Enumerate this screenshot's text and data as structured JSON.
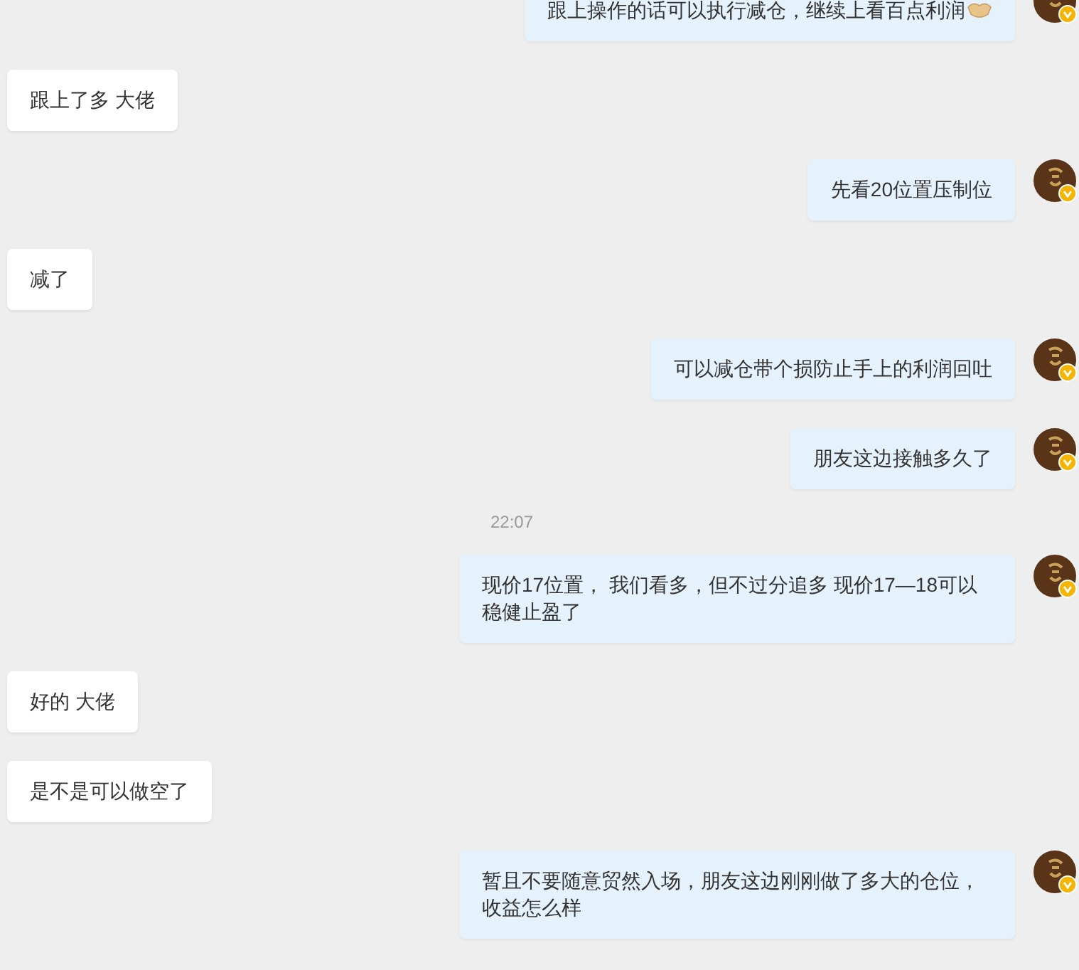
{
  "messages": [
    {
      "kind": "sent",
      "text": "跟上操作的话可以执行减仓，继续上看百点利润",
      "emoji": true
    },
    {
      "kind": "received",
      "text": "跟上了多 大佬"
    },
    {
      "kind": "sent",
      "text": "先看20位置压制位"
    },
    {
      "kind": "received",
      "text": "减了"
    },
    {
      "kind": "sent",
      "text": "可以减仓带个损防止手上的利润回吐"
    },
    {
      "kind": "sent",
      "text": "朋友这边接触多久了"
    },
    {
      "kind": "time",
      "text": "22:07"
    },
    {
      "kind": "sent",
      "text": "现价17位置， 我们看多，但不过分追多 现价17—18可以稳健止盈了"
    },
    {
      "kind": "received",
      "text": "好的 大佬"
    },
    {
      "kind": "received",
      "text": "是不是可以做空了"
    },
    {
      "kind": "sent",
      "text": "暂且不要随意贸然入场，朋友这边刚刚做了多大的仓位，收益怎么样"
    }
  ]
}
